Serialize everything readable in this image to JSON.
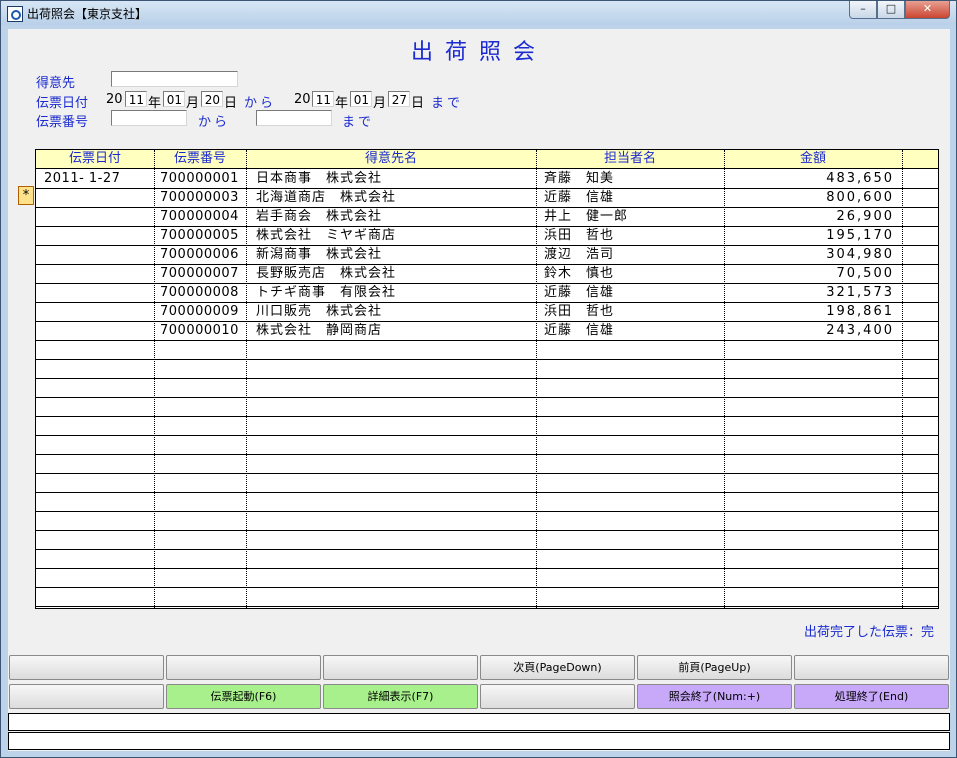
{
  "window": {
    "title": "出荷照会【東京支社】",
    "minimize": "–",
    "maximize": "□",
    "close": "✕"
  },
  "form": {
    "title": "出荷照会",
    "customer_label": "得意先",
    "customer_value": "",
    "date_label": "伝票日付",
    "date_from": {
      "century": "20",
      "year": "11",
      "year_unit": "年",
      "month": "01",
      "month_unit": "月",
      "day": "20",
      "day_unit": "日"
    },
    "from_word": "から",
    "date_to": {
      "century": "20",
      "year": "11",
      "year_unit": "年",
      "month": "01",
      "month_unit": "月",
      "day": "27",
      "day_unit": "日"
    },
    "to_word": "まで",
    "slip_label": "伝票番号",
    "slip_from": "",
    "slip_to": ""
  },
  "table": {
    "headers": [
      "伝票日付",
      "伝票番号",
      "得意先名",
      "担当者名",
      "金額"
    ],
    "rows": [
      {
        "date": "2011- 1-27",
        "no": "700000001",
        "customer": "日本商事　株式会社",
        "staff": "斉藤　知美",
        "amount": "483,650"
      },
      {
        "date": "",
        "no": "700000003",
        "customer": "北海道商店　株式会社",
        "staff": "近藤　信雄",
        "amount": "800,600"
      },
      {
        "date": "",
        "no": "700000004",
        "customer": "岩手商会　株式会社",
        "staff": "井上　健一郎",
        "amount": "26,900"
      },
      {
        "date": "",
        "no": "700000005",
        "customer": "株式会社　ミヤギ商店",
        "staff": "浜田　哲也",
        "amount": "195,170"
      },
      {
        "date": "",
        "no": "700000006",
        "customer": "新潟商事　株式会社",
        "staff": "渡辺　浩司",
        "amount": "304,980"
      },
      {
        "date": "",
        "no": "700000007",
        "customer": "長野販売店　株式会社",
        "staff": "鈴木　慎也",
        "amount": "70,500"
      },
      {
        "date": "",
        "no": "700000008",
        "customer": "トチギ商事　有限会社",
        "staff": "近藤　信雄",
        "amount": "321,573"
      },
      {
        "date": "",
        "no": "700000009",
        "customer": "川口販売　株式会社",
        "staff": "浜田　哲也",
        "amount": "198,861"
      },
      {
        "date": "",
        "no": "700000010",
        "customer": "株式会社　静岡商店",
        "staff": "近藤　信雄",
        "amount": "243,400"
      }
    ],
    "row_marker": "*"
  },
  "note": "出荷完了した伝票：完",
  "function_keys": {
    "row1": [
      "",
      "",
      "",
      "次頁(PageDown)",
      "前頁(PageUp)",
      ""
    ],
    "row2": [
      "",
      "伝票起動(F6)",
      "詳細表示(F7)",
      "",
      "照会終了(Num:+)",
      "処理終了(End)"
    ]
  },
  "colors": {
    "label_blue": "#1b2bd1",
    "header_yellow": "#ffffc0",
    "key_green": "#a8f08c",
    "key_purple": "#c8a8f8"
  }
}
